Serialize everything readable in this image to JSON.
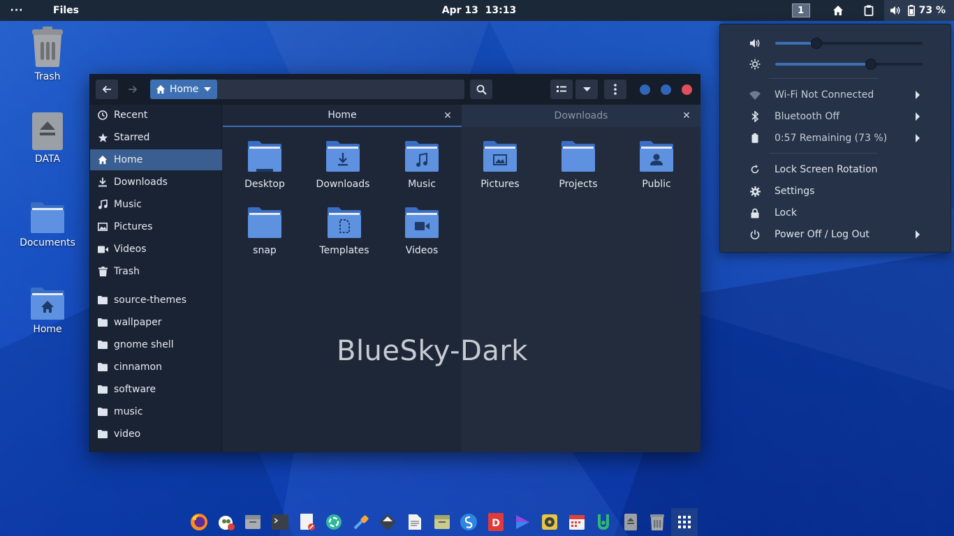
{
  "topbar": {
    "activities_label": "···",
    "app_name": "Files",
    "date": "Apr 13",
    "time": "13:13",
    "workspace": "1",
    "battery_percent": "73 %"
  },
  "desktop_icons": [
    {
      "label": "Trash",
      "icon": "trash-icon"
    },
    {
      "label": "DATA",
      "icon": "drive-icon"
    },
    {
      "label": "Documents",
      "icon": "folder-icon"
    },
    {
      "label": "Home",
      "icon": "home-folder-icon"
    }
  ],
  "window": {
    "location_label": "Home",
    "sidebar": [
      {
        "label": "Recent",
        "icon": "clock-icon"
      },
      {
        "label": "Starred",
        "icon": "star-icon"
      },
      {
        "label": "Home",
        "icon": "home-icon",
        "active": true
      },
      {
        "label": "Downloads",
        "icon": "download-icon"
      },
      {
        "label": "Music",
        "icon": "music-icon"
      },
      {
        "label": "Pictures",
        "icon": "image-icon"
      },
      {
        "label": "Videos",
        "icon": "video-icon"
      },
      {
        "label": "Trash",
        "icon": "trash-icon"
      },
      {
        "label": "source-themes",
        "icon": "folder-icon"
      },
      {
        "label": "wallpaper",
        "icon": "folder-icon"
      },
      {
        "label": "gnome shell",
        "icon": "folder-icon"
      },
      {
        "label": "cinnamon",
        "icon": "folder-icon"
      },
      {
        "label": "software",
        "icon": "folder-icon"
      },
      {
        "label": "music",
        "icon": "folder-icon"
      },
      {
        "label": "video",
        "icon": "folder-icon"
      }
    ],
    "tabs": [
      {
        "label": "Home",
        "active": true
      },
      {
        "label": "Downloads",
        "active": false
      }
    ],
    "files": [
      {
        "label": "Desktop",
        "emblem": "desktop"
      },
      {
        "label": "Downloads",
        "emblem": "download"
      },
      {
        "label": "Music",
        "emblem": "music"
      },
      {
        "label": "Pictures",
        "emblem": "image"
      },
      {
        "label": "Projects",
        "emblem": "none"
      },
      {
        "label": "Public",
        "emblem": "person"
      },
      {
        "label": "snap",
        "emblem": "none"
      },
      {
        "label": "Templates",
        "emblem": "document"
      },
      {
        "label": "Videos",
        "emblem": "video"
      }
    ],
    "watermark": "BlueSky-Dark"
  },
  "system_menu": {
    "volume_level": 0.28,
    "brightness_level": 0.65,
    "items": [
      {
        "label": "Wi-Fi Not Connected",
        "icon": "wifi-icon",
        "submenu": true
      },
      {
        "label": "Bluetooth Off",
        "icon": "bluetooth-icon",
        "submenu": true
      },
      {
        "label": "0:57 Remaining (73 %)",
        "icon": "battery-icon",
        "submenu": true
      },
      {
        "label": "Lock Screen Rotation",
        "icon": "rotation-icon",
        "submenu": false
      },
      {
        "label": "Settings",
        "icon": "gear-icon",
        "submenu": false
      },
      {
        "label": "Lock",
        "icon": "lock-icon",
        "submenu": false
      },
      {
        "label": "Power Off / Log Out",
        "icon": "power-icon",
        "submenu": true
      }
    ]
  },
  "dock": [
    "firefox-icon",
    "gimp-icon",
    "files-icon",
    "terminal-icon",
    "text-editor-icon",
    "recycle-app-icon",
    "color-picker-icon",
    "inkscape-icon",
    "document-icon",
    "files-alt-icon",
    "simplenote-icon",
    "docs-app-icon",
    "media-player-icon",
    "rhythmbox-icon",
    "calendar-icon",
    "git-icon",
    "drive-icon",
    "trash-icon",
    "show-apps-icon"
  ],
  "colors": {
    "accent": "#3d6fb3",
    "panel": "#1b2838",
    "window_bg": "#1e2738",
    "folder_blue": "#5e92e0",
    "close_red": "#e0505a"
  }
}
